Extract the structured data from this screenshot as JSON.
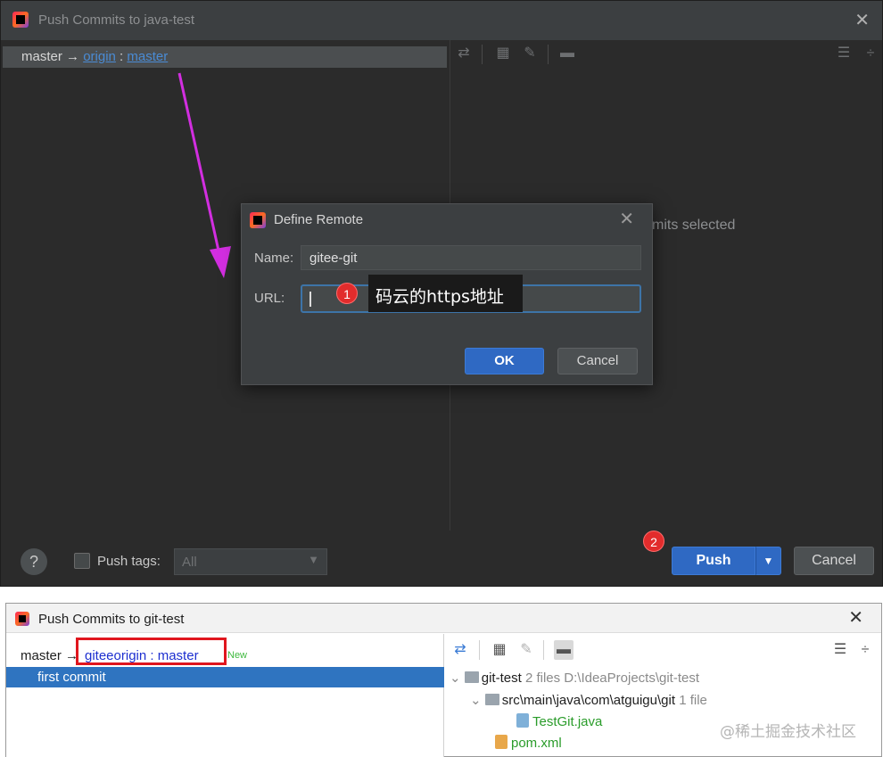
{
  "top_dialog": {
    "title": "Push Commits to java-test",
    "branch_local": "master",
    "branch_arrow": "→",
    "remote_name": "origin",
    "remote_separator": " : ",
    "remote_branch": "master",
    "right_pane_message": "mits selected",
    "close": "✕"
  },
  "define_remote": {
    "title": "Define Remote",
    "close": "✕",
    "name_label": "Name:",
    "name_value": "gitee-git",
    "url_label": "URL:",
    "url_value": "",
    "tooltip_text": "码云的https地址",
    "badge_1": "1",
    "ok_label": "OK",
    "cancel_label": "Cancel"
  },
  "bottom_bar": {
    "help": "?",
    "push_tags_label": "Push tags:",
    "push_tags_value": "All",
    "badge_2": "2",
    "push_label": "Push",
    "push_dropdown": "▼",
    "cancel_label": "Cancel"
  },
  "light_dialog": {
    "title": "Push Commits to git-test",
    "close": "✕",
    "branch_local": "master",
    "branch_arrow": "→",
    "remote": "giteeorigin : master",
    "new_tag": "New",
    "commit": "first commit",
    "tree": {
      "root_name": "git-test",
      "root_info": "2 files  D:\\IdeaProjects\\git-test",
      "folder_name": "src\\main\\java\\com\\atguigu\\git",
      "folder_info": "1 file",
      "file1": "TestGit.java",
      "file2": "pom.xml"
    }
  },
  "watermark": "@稀土掘金技术社区",
  "colors": {
    "accent_blue": "#2f69c3",
    "dark_bg": "#2b2b2b",
    "arrow_magenta": "#d22ee0",
    "highlight_red": "#e0161e",
    "selection_blue": "#2f74c0"
  }
}
